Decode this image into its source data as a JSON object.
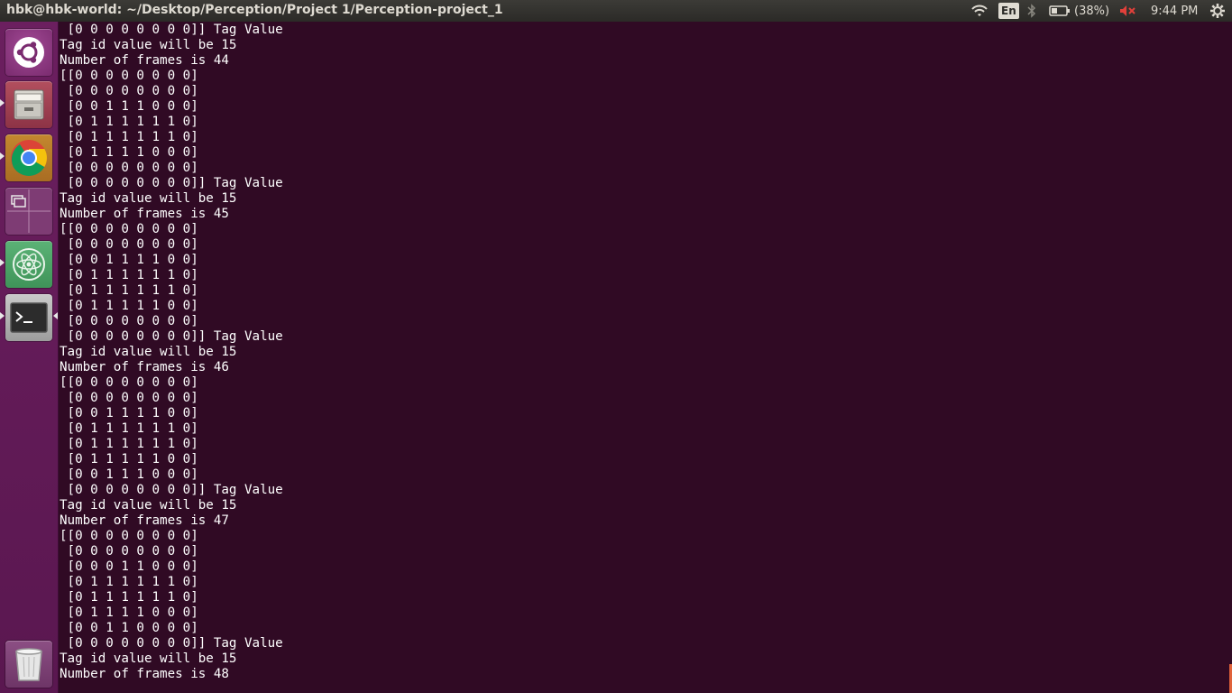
{
  "panel": {
    "window_title": "hbk@hbk-world: ~/Desktop/Perception/Project 1/Perception-project_1",
    "keyboard_layout": "En",
    "battery_percent": "(38%)",
    "clock": "9:44 PM",
    "icons": [
      "wifi-icon",
      "bluetooth-icon",
      "battery-icon",
      "volume-muted-icon",
      "settings-gear-icon"
    ]
  },
  "launcher": {
    "items": [
      {
        "name": "ubuntu-dash-icon"
      },
      {
        "name": "files-icon"
      },
      {
        "name": "chrome-icon"
      },
      {
        "name": "workspace-switcher-icon"
      },
      {
        "name": "atom-icon"
      },
      {
        "name": "terminal-icon"
      },
      {
        "name": "trash-icon"
      }
    ]
  },
  "terminal": {
    "lines": [
      " [0 0 0 0 0 0 0 0]] Tag Value",
      "Tag id value will be 15",
      "Number of frames is 44",
      "[[0 0 0 0 0 0 0 0]",
      " [0 0 0 0 0 0 0 0]",
      " [0 0 1 1 1 0 0 0]",
      " [0 1 1 1 1 1 1 0]",
      " [0 1 1 1 1 1 1 0]",
      " [0 1 1 1 1 0 0 0]",
      " [0 0 0 0 0 0 0 0]",
      " [0 0 0 0 0 0 0 0]] Tag Value",
      "Tag id value will be 15",
      "Number of frames is 45",
      "[[0 0 0 0 0 0 0 0]",
      " [0 0 0 0 0 0 0 0]",
      " [0 0 1 1 1 1 0 0]",
      " [0 1 1 1 1 1 1 0]",
      " [0 1 1 1 1 1 1 0]",
      " [0 1 1 1 1 1 0 0]",
      " [0 0 0 0 0 0 0 0]",
      " [0 0 0 0 0 0 0 0]] Tag Value",
      "Tag id value will be 15",
      "Number of frames is 46",
      "[[0 0 0 0 0 0 0 0]",
      " [0 0 0 0 0 0 0 0]",
      " [0 0 1 1 1 1 0 0]",
      " [0 1 1 1 1 1 1 0]",
      " [0 1 1 1 1 1 1 0]",
      " [0 1 1 1 1 1 0 0]",
      " [0 0 1 1 1 0 0 0]",
      " [0 0 0 0 0 0 0 0]] Tag Value",
      "Tag id value will be 15",
      "Number of frames is 47",
      "[[0 0 0 0 0 0 0 0]",
      " [0 0 0 0 0 0 0 0]",
      " [0 0 0 1 1 0 0 0]",
      " [0 1 1 1 1 1 1 0]",
      " [0 1 1 1 1 1 1 0]",
      " [0 1 1 1 1 0 0 0]",
      " [0 0 1 1 0 0 0 0]",
      " [0 0 0 0 0 0 0 0]] Tag Value",
      "Tag id value will be 15",
      "Number of frames is 48"
    ]
  },
  "colors": {
    "terminal_bg": "#300a24",
    "terminal_fg": "#ffffff",
    "panel_bg": "#3c3b37",
    "launcher_bg": "#6b1f5f",
    "mute_red": "#e0403a"
  }
}
